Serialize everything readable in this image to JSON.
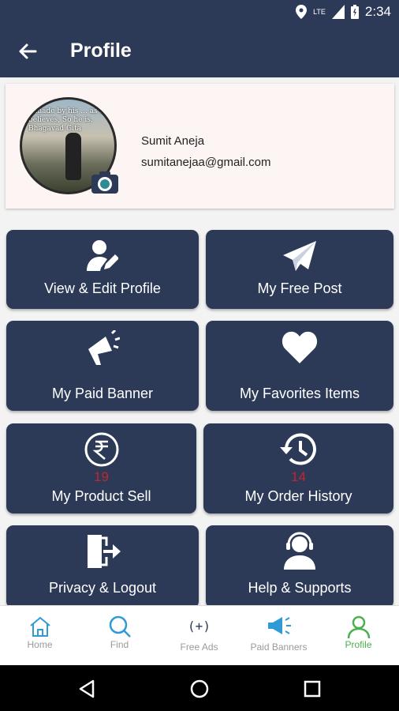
{
  "status": {
    "network": "LTE",
    "time": "2:34"
  },
  "header": {
    "title": "Profile"
  },
  "profile": {
    "name": "Sumit Aneja",
    "email": "sumitanejaa@gmail.com",
    "avatar_quote": "...made by his ... as he believes, So he is. Bhagavad Gita"
  },
  "tiles": [
    {
      "label": "View & Edit Profile",
      "icon": "user-edit-icon"
    },
    {
      "label": "My Free Post",
      "icon": "paper-plane-icon"
    },
    {
      "label": "My Paid Banner",
      "icon": "megaphone-icon"
    },
    {
      "label": "My Favorites Items",
      "icon": "heart-icon"
    },
    {
      "label": "My Product Sell",
      "icon": "rupee-icon",
      "count": "19"
    },
    {
      "label": "My Order History",
      "icon": "history-icon",
      "count": "14"
    },
    {
      "label": "Privacy & Logout",
      "icon": "logout-icon"
    },
    {
      "label": "Help & Supports",
      "icon": "support-icon"
    }
  ],
  "bottom_nav": [
    {
      "label": "Home",
      "icon": "home-icon"
    },
    {
      "label": "Find",
      "icon": "search-icon"
    },
    {
      "label": "Free Ads",
      "icon": "plus-icon",
      "glyph": "(+)"
    },
    {
      "label": "Paid Banners",
      "icon": "megaphone-icon"
    },
    {
      "label": "Profile",
      "icon": "profile-icon",
      "active": true
    }
  ],
  "colors": {
    "primary": "#2c3a57",
    "accent_green": "#4caf50",
    "nav_blue": "#2f9ad6",
    "count_red": "#c0272d"
  }
}
